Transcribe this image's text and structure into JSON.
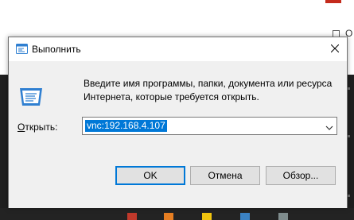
{
  "background": {
    "partial_letter": "O"
  },
  "dialog": {
    "title": "Выполнить",
    "description": "Введите имя программы, папки, документа или ресурса Интернета, которые требуется открыть.",
    "open_label_underlined": "О",
    "open_label_rest": "ткрыть:",
    "input_value": "vnc:192.168.4.107",
    "buttons": {
      "ok": "OK",
      "cancel": "Отмена",
      "browse": "Обзор..."
    }
  },
  "icons": {
    "title": "run-icon",
    "large": "run-icon",
    "close": "close-icon",
    "dropdown": "chevron-down-icon"
  },
  "colors": {
    "selection": "#0078d7",
    "default_button_border": "#0078d7",
    "dialog_bg": "#f0f0f0",
    "run_icon_blue": "#2f7fd1"
  }
}
